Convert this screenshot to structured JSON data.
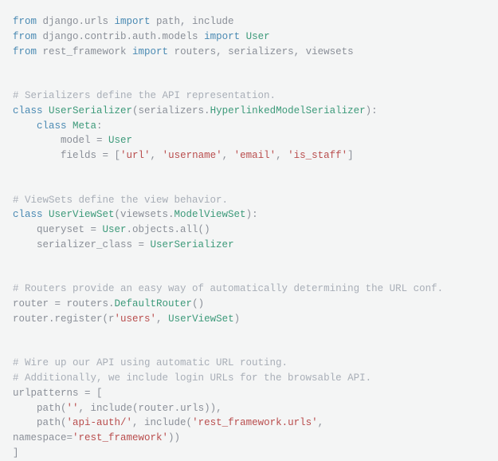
{
  "lines": {
    "l1": {
      "from": "from ",
      "mod": "django.urls ",
      "imp": "import ",
      "items": "path, include"
    },
    "l2": {
      "from": "from ",
      "mod": "django.contrib.auth.models ",
      "imp": "import ",
      "items": "User"
    },
    "l3": {
      "from": "from ",
      "mod": "rest_framework ",
      "imp": "import ",
      "items": "routers, serializers, viewsets"
    },
    "l4": "# Serializers define the API representation.",
    "l5": {
      "kw": "class ",
      "name": "UserSerializer",
      "paren1": "(serializers.",
      "base": "HyperlinkedModelSerializer",
      "paren2": "):"
    },
    "l6": {
      "indent": "    ",
      "kw": "class ",
      "name": "Meta",
      "colon": ":"
    },
    "l7": {
      "indent": "        ",
      "lhs": "model = ",
      "rhs": "User"
    },
    "l8": {
      "indent": "        ",
      "lhs": "fields = [",
      "s1": "'url'",
      "c1": ", ",
      "s2": "'username'",
      "c2": ", ",
      "s3": "'email'",
      "c3": ", ",
      "s4": "'is_staff'",
      "end": "]"
    },
    "l9": "# ViewSets define the view behavior.",
    "l10": {
      "kw": "class ",
      "name": "UserViewSet",
      "paren1": "(viewsets.",
      "base": "ModelViewSet",
      "paren2": "):"
    },
    "l11": {
      "indent": "    ",
      "lhs": "queryset = ",
      "cls": "User",
      "rest": ".objects.all()"
    },
    "l12": {
      "indent": "    ",
      "lhs": "serializer_class = ",
      "cls": "UserSerializer"
    },
    "l13": "# Routers provide an easy way of automatically determining the URL conf.",
    "l14": {
      "lhs": "router = routers.",
      "fn": "DefaultRouter",
      "rest": "()"
    },
    "l15": {
      "lhs": "router.register(r",
      "s1": "'users'",
      "c1": ", ",
      "cls": "UserViewSet",
      "rest": ")"
    },
    "l16": "# Wire up our API using automatic URL routing.",
    "l17": "# Additionally, we include login URLs for the browsable API.",
    "l18": "urlpatterns = [",
    "l19": {
      "indent": "    ",
      "fn": "path(",
      "s1": "''",
      "c1": ", include(router.urls)),"
    },
    "l20": {
      "indent": "    ",
      "fn": "path(",
      "s1": "'api-auth/'",
      "c1": ", include(",
      "s2": "'rest_framework.urls'",
      "c2": ", namespace=",
      "s3": "'rest_framework'",
      "end": "))"
    },
    "l21": "]"
  }
}
